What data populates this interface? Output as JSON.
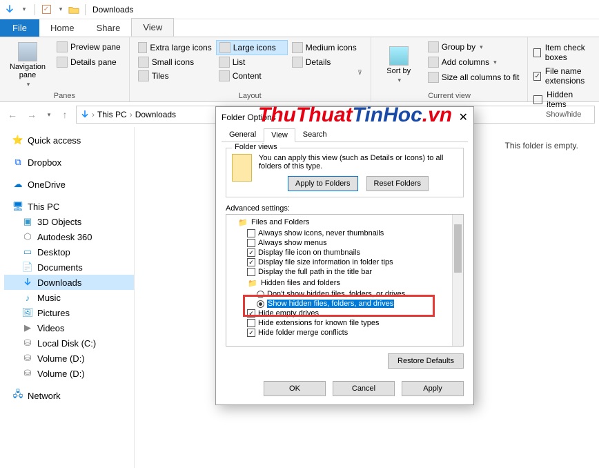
{
  "titlebar": {
    "title": "Downloads"
  },
  "tabs": {
    "file": "File",
    "home": "Home",
    "share": "Share",
    "view": "View"
  },
  "ribbon": {
    "panes": {
      "group": "Panes",
      "nav": "Navigation pane",
      "preview": "Preview pane",
      "details": "Details pane"
    },
    "layout": {
      "group": "Layout",
      "items": {
        "xl": "Extra large icons",
        "lg": "Large icons",
        "md": "Medium icons",
        "sm": "Small icons",
        "list": "List",
        "det": "Details",
        "tiles": "Tiles",
        "content": "Content"
      }
    },
    "currentview": {
      "group": "Current view",
      "sort": "Sort by",
      "group_by": "Group by",
      "addcols": "Add columns",
      "sizeall": "Size all columns to fit"
    },
    "showhide": {
      "group": "Show/hide",
      "itemcheck": "Item check boxes",
      "fne": "File name extensions",
      "hidden": "Hidden items"
    }
  },
  "breadcrumb": {
    "thispc": "This PC",
    "downloads": "Downloads"
  },
  "sidebar": {
    "quick": "Quick access",
    "dropbox": "Dropbox",
    "onedrive": "OneDrive",
    "thispc": "This PC",
    "obj3d": "3D Objects",
    "autodesk": "Autodesk 360",
    "desktop": "Desktop",
    "documents": "Documents",
    "downloads": "Downloads",
    "music": "Music",
    "pictures": "Pictures",
    "videos": "Videos",
    "localc": "Local Disk (C:)",
    "vold1": "Volume (D:)",
    "vold2": "Volume (D:)",
    "network": "Network"
  },
  "content": {
    "empty": "This folder is empty."
  },
  "dialog": {
    "title": "Folder Options",
    "tabs": {
      "general": "General",
      "view": "View",
      "search": "Search"
    },
    "fv": {
      "legend": "Folder views",
      "text": "You can apply this view (such as Details or Icons) to all folders of this type.",
      "apply": "Apply to Folders",
      "reset": "Reset Folders"
    },
    "adv": {
      "label": "Advanced settings:",
      "root": "Files and Folders",
      "i1": "Always show icons, never thumbnails",
      "i2": "Always show menus",
      "i3": "Display file icon on thumbnails",
      "i4": "Display file size information in folder tips",
      "i5": "Display the full path in the title bar",
      "hgroup": "Hidden files and folders",
      "r1": "Don't show hidden files, folders, or drives",
      "r2": "Show hidden files, folders, and drives",
      "i6": "Hide empty drives",
      "i7": "Hide extensions for known file types",
      "i8": "Hide folder merge conflicts"
    },
    "restore": "Restore Defaults",
    "ok": "OK",
    "cancel": "Cancel",
    "apply_btn": "Apply"
  },
  "watermark": {
    "p1": "ThuThuat",
    "p2": "TinHoc",
    "p3": ".vn"
  }
}
